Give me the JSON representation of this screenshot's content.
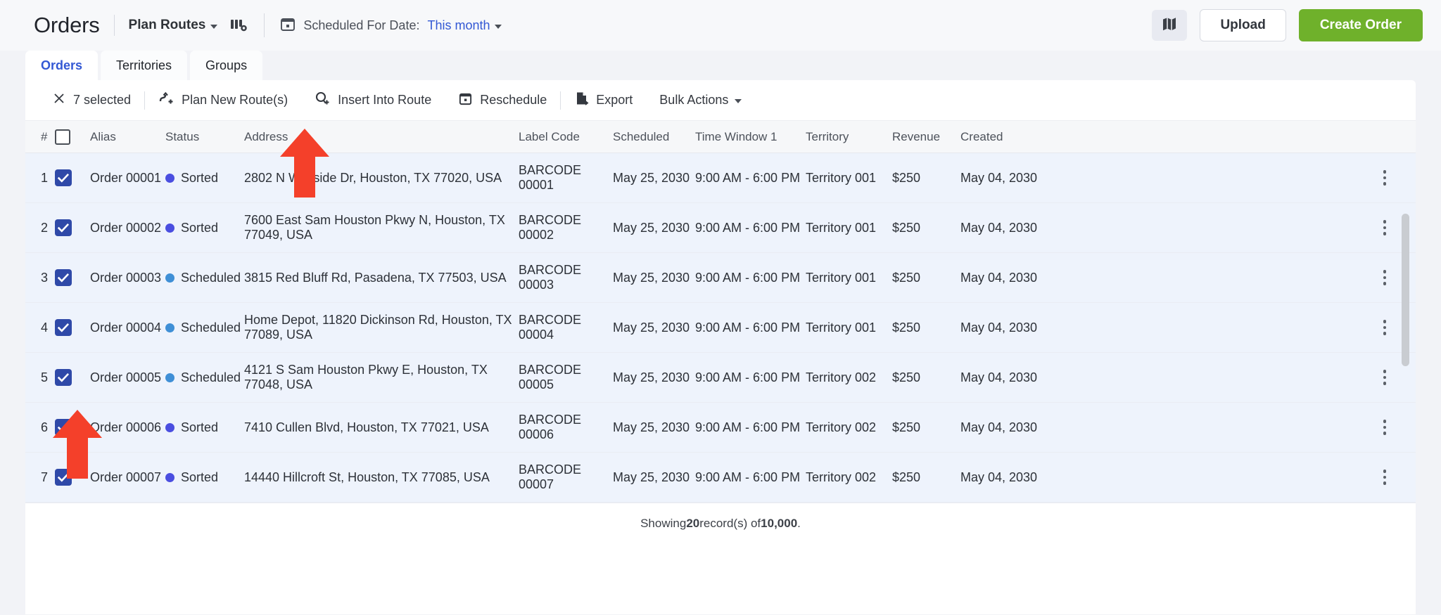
{
  "header": {
    "title": "Orders",
    "plan_routes": "Plan Routes",
    "grid_icon": "route-settings-icon",
    "calendar_icon": "calendar-icon",
    "scheduled_for_date_label": "Scheduled For Date:",
    "scheduled_for_date_value": "This month",
    "map_icon": "map-icon",
    "upload_label": "Upload",
    "create_order_label": "Create Order",
    "accent_green": "#6fb12b",
    "accent_blue": "#3358d4"
  },
  "tabs": [
    {
      "label": "Orders",
      "active": true
    },
    {
      "label": "Territories",
      "active": false
    },
    {
      "label": "Groups",
      "active": false
    }
  ],
  "actionbar": {
    "close_icon": "close-icon",
    "selected_count": "7 selected",
    "actions": [
      {
        "label": "Plan New Route(s)",
        "icon": "route-plus-icon"
      },
      {
        "label": "Insert Into Route",
        "icon": "pin-plus-icon"
      },
      {
        "label": "Reschedule",
        "icon": "calendar-icon"
      },
      {
        "label": "Export",
        "icon": "file-export-icon"
      },
      {
        "label": "Bulk Actions",
        "icon": "chevron-down-icon"
      }
    ]
  },
  "table": {
    "columns": [
      "#",
      "",
      "Alias",
      "Status",
      "Address",
      "Label Code",
      "Scheduled",
      "Time Window 1",
      "Territory",
      "Revenue",
      "Created"
    ],
    "header_checkbox_checked": false,
    "status_colors": {
      "Sorted": "#4a4ee0",
      "Scheduled": "#3f8fd6"
    },
    "rows": [
      {
        "num": "1",
        "checked": true,
        "alias": "Order 00001",
        "status": "Sorted",
        "address": "2802 N Wayside Dr, Houston, TX 77020, USA",
        "label_code": "BARCODE 00001",
        "scheduled": "May 25, 2030",
        "time_window": "9:00 AM - 6:00 PM",
        "territory": "Territory 001",
        "revenue": "$250",
        "created": "May 04, 2030"
      },
      {
        "num": "2",
        "checked": true,
        "alias": "Order 00002",
        "status": "Sorted",
        "address": "7600 East Sam Houston Pkwy N, Houston, TX 77049, USA",
        "label_code": "BARCODE 00002",
        "scheduled": "May 25, 2030",
        "time_window": "9:00 AM - 6:00 PM",
        "territory": "Territory 001",
        "revenue": "$250",
        "created": "May 04, 2030"
      },
      {
        "num": "3",
        "checked": true,
        "alias": "Order 00003",
        "status": "Scheduled",
        "address": "3815 Red Bluff Rd, Pasadena, TX 77503, USA",
        "label_code": "BARCODE 00003",
        "scheduled": "May 25, 2030",
        "time_window": "9:00 AM - 6:00 PM",
        "territory": "Territory 001",
        "revenue": "$250",
        "created": "May 04, 2030"
      },
      {
        "num": "4",
        "checked": true,
        "alias": "Order 00004",
        "status": "Scheduled",
        "address": "Home Depot, 11820 Dickinson Rd, Houston, TX 77089, USA",
        "label_code": "BARCODE 00004",
        "scheduled": "May 25, 2030",
        "time_window": "9:00 AM - 6:00 PM",
        "territory": "Territory 001",
        "revenue": "$250",
        "created": "May 04, 2030"
      },
      {
        "num": "5",
        "checked": true,
        "alias": "Order 00005",
        "status": "Scheduled",
        "address": "4121 S Sam Houston Pkwy E, Houston, TX 77048, USA",
        "label_code": "BARCODE 00005",
        "scheduled": "May 25, 2030",
        "time_window": "9:00 AM - 6:00 PM",
        "territory": "Territory 002",
        "revenue": "$250",
        "created": "May 04, 2030"
      },
      {
        "num": "6",
        "checked": true,
        "alias": "Order 00006",
        "status": "Sorted",
        "address": "7410 Cullen Blvd, Houston, TX 77021, USA",
        "label_code": "BARCODE 00006",
        "scheduled": "May 25, 2030",
        "time_window": "9:00 AM - 6:00 PM",
        "territory": "Territory 002",
        "revenue": "$250",
        "created": "May 04, 2030"
      },
      {
        "num": "7",
        "checked": true,
        "alias": "Order 00007",
        "status": "Sorted",
        "address": "14440 Hillcroft St, Houston, TX 77085, USA",
        "label_code": "BARCODE 00007",
        "scheduled": "May 25, 2030",
        "time_window": "9:00 AM - 6:00 PM",
        "territory": "Territory 002",
        "revenue": "$250",
        "created": "May 04, 2030"
      }
    ]
  },
  "footer": {
    "prefix": "Showing ",
    "count": "20",
    "middle": " record(s) of ",
    "total": "10,000",
    "suffix": "."
  },
  "annotations": {
    "arrow_color": "#f4402a",
    "arrows": [
      {
        "name": "arrow-insert-into-route"
      },
      {
        "name": "arrow-row7-checkbox"
      }
    ]
  }
}
